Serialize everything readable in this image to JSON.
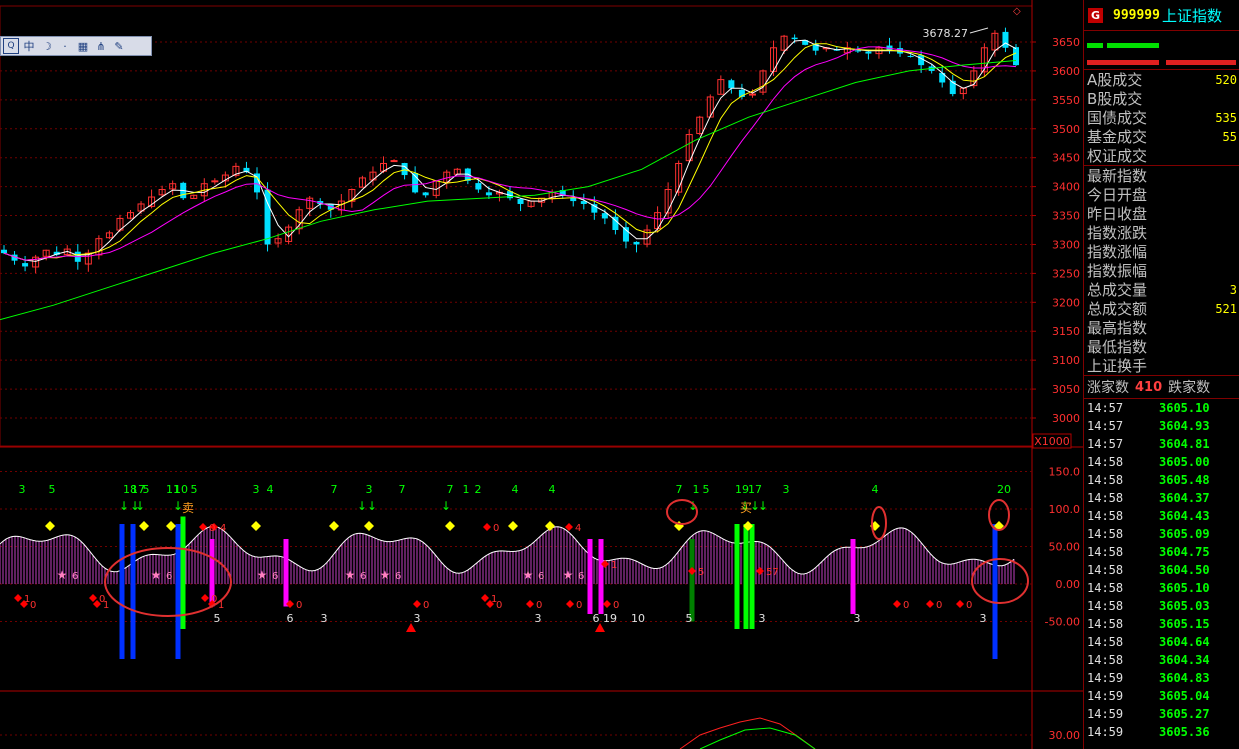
{
  "toolbar": {
    "icons": [
      "logo-icon",
      "chinese-input-icon",
      "moon-icon",
      "dot-icon",
      "keyboard-icon",
      "network-icon",
      "wrench-icon"
    ],
    "input_label": "中"
  },
  "chart_data": [
    {
      "type": "candlestick",
      "title": "",
      "price_axis_ticks": [
        3650,
        3600,
        3550,
        3500,
        3450,
        3400,
        3350,
        3300,
        3250,
        3200,
        3150,
        3100,
        3050,
        3000
      ],
      "ylim": [
        2955,
        3700
      ],
      "high_label": "3678.27",
      "grid": "horizontal dotted",
      "ma_colors": {
        "ma5": "#ffffff",
        "ma10": "#ffff00",
        "ma20": "#ff00ff",
        "ma60": "#00ff00"
      },
      "close_series_approx": [
        3285,
        3272,
        3262,
        3278,
        3290,
        3282,
        3292,
        3270,
        3285,
        3310,
        3320,
        3345,
        3355,
        3370,
        3382,
        3395,
        3405,
        3380,
        3385,
        3405,
        3410,
        3420,
        3435,
        3425,
        3390,
        3300,
        3310,
        3330,
        3360,
        3380,
        3370,
        3360,
        3375,
        3395,
        3415,
        3425,
        3440,
        3445,
        3420,
        3390,
        3385,
        3410,
        3425,
        3430,
        3410,
        3395,
        3385,
        3390,
        3380,
        3370,
        3375,
        3380,
        3390,
        3385,
        3375,
        3370,
        3355,
        3345,
        3325,
        3305,
        3300,
        3325,
        3355,
        3395,
        3440,
        3490,
        3520,
        3555,
        3585,
        3570,
        3555,
        3560,
        3600,
        3640,
        3660,
        3655,
        3645,
        3635,
        3640,
        3635,
        3640,
        3635,
        3630,
        3640,
        3635,
        3630,
        3625,
        3610,
        3600,
        3580,
        3560,
        3570,
        3600,
        3640,
        3665,
        3640,
        3610
      ],
      "ma60_approx": [
        3170,
        3195,
        3225,
        3255,
        3285,
        3310,
        3340,
        3360,
        3375,
        3380,
        3385,
        3400,
        3430,
        3480,
        3520,
        3550,
        3580,
        3600,
        3610,
        3618
      ],
      "frame_label": "X1000"
    },
    {
      "type": "bar+line",
      "title": "",
      "yaxis_ticks": [
        "150.0",
        "100.0",
        "50.00",
        "0.00",
        "-50.00"
      ],
      "ylim": [
        -100,
        175
      ],
      "top_numbers": [
        "3",
        "5",
        "18",
        "17",
        "5",
        "11",
        "10",
        "5",
        "3",
        "4",
        "7",
        "3",
        "7",
        "7",
        "1",
        "2",
        "4",
        "4",
        "7",
        "1",
        "5",
        "19",
        "17",
        "3",
        "4",
        "20"
      ],
      "bottom_numbers": [
        "5",
        "6",
        "3",
        "3",
        "3",
        "6",
        "19",
        "10",
        "5",
        "3",
        "3",
        "3"
      ],
      "labels": {
        "sell": "卖",
        "buy": "买"
      },
      "star_labels": [
        "6",
        "6",
        "6",
        "6",
        "6",
        "6",
        "6"
      ],
      "diamond_labels": [
        "1",
        "0",
        "0",
        "1",
        "0",
        "1",
        "4",
        "0",
        "0",
        "1",
        "0",
        "0",
        "0",
        "4",
        "1",
        "0",
        "0",
        "0",
        "0",
        "0",
        "0",
        "5",
        "57"
      ]
    },
    {
      "type": "line",
      "title": "",
      "yaxis_ticks": [
        "30.00"
      ],
      "ylim": [
        0,
        60
      ],
      "series_colors": [
        "#ff2020",
        "#00ff00"
      ]
    }
  ],
  "right_panel": {
    "badge": "G",
    "code": "999999",
    "name": "上证指数",
    "stats": [
      {
        "label": "A股成交",
        "value": "520"
      },
      {
        "label": "B股成交",
        "value": ""
      },
      {
        "label": "国债成交",
        "value": "535"
      },
      {
        "label": "基金成交",
        "value": "55"
      },
      {
        "label": "权证成交",
        "value": ""
      }
    ],
    "quote": [
      {
        "label": "最新指数",
        "value": ""
      },
      {
        "label": "今日开盘",
        "value": ""
      },
      {
        "label": "昨日收盘",
        "value": ""
      },
      {
        "label": "指数涨跌",
        "value": ""
      },
      {
        "label": "指数涨幅",
        "value": ""
      },
      {
        "label": "指数振幅",
        "value": ""
      },
      {
        "label": "总成交量",
        "value": "3"
      },
      {
        "label": "总成交额",
        "value": "521"
      },
      {
        "label": "最高指数",
        "value": ""
      },
      {
        "label": "最低指数",
        "value": ""
      },
      {
        "label": "上证换手",
        "value": ""
      }
    ],
    "up_label": "涨家数",
    "up_count": "410",
    "down_label": "跌家数",
    "ticks": [
      {
        "time": "14:57",
        "value": "3605.10"
      },
      {
        "time": "14:57",
        "value": "3604.93"
      },
      {
        "time": "14:57",
        "value": "3604.81"
      },
      {
        "time": "14:58",
        "value": "3605.00"
      },
      {
        "time": "14:58",
        "value": "3605.48"
      },
      {
        "time": "14:58",
        "value": "3604.37"
      },
      {
        "time": "14:58",
        "value": "3604.43"
      },
      {
        "time": "14:58",
        "value": "3605.09"
      },
      {
        "time": "14:58",
        "value": "3604.75"
      },
      {
        "time": "14:58",
        "value": "3604.50"
      },
      {
        "time": "14:58",
        "value": "3605.10"
      },
      {
        "time": "14:58",
        "value": "3605.03"
      },
      {
        "time": "14:58",
        "value": "3605.15"
      },
      {
        "time": "14:58",
        "value": "3604.64"
      },
      {
        "time": "14:58",
        "value": "3604.34"
      },
      {
        "time": "14:59",
        "value": "3604.83"
      },
      {
        "time": "14:59",
        "value": "3605.04"
      },
      {
        "time": "14:59",
        "value": "3605.27"
      },
      {
        "time": "14:59",
        "value": "3605.36"
      }
    ]
  }
}
